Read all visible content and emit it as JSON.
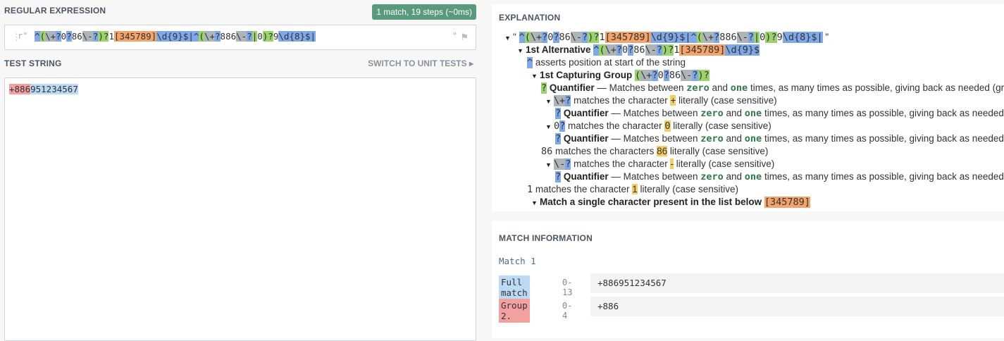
{
  "regex": {
    "title": "REGULAR EXPRESSION",
    "badge": "1 match, 19 steps (~0ms)",
    "prefix": "r\"",
    "suffix": "\"",
    "parts": [
      {
        "t": "^",
        "c": "hb"
      },
      {
        "t": "(",
        "c": "hg"
      },
      {
        "t": "\\+",
        "c": "hgr"
      },
      {
        "t": "?",
        "c": "hb"
      },
      {
        "t": "0",
        "c": ""
      },
      {
        "t": "?",
        "c": "hb"
      },
      {
        "t": "86",
        "c": ""
      },
      {
        "t": "\\-",
        "c": "hgr"
      },
      {
        "t": "?",
        "c": "hb"
      },
      {
        "t": ")",
        "c": "hg"
      },
      {
        "t": "?",
        "c": "hg"
      },
      {
        "t": "1",
        "c": ""
      },
      {
        "t": "[",
        "c": "ho"
      },
      {
        "t": "345789",
        "c": "ho"
      },
      {
        "t": "]",
        "c": "ho"
      },
      {
        "t": "\\d",
        "c": "hb"
      },
      {
        "t": "{9}",
        "c": "hb"
      },
      {
        "t": "$",
        "c": "hb"
      },
      {
        "t": "|",
        "c": "hb"
      },
      {
        "t": "^",
        "c": "hb"
      },
      {
        "t": "(",
        "c": "hg"
      },
      {
        "t": "\\+",
        "c": "hgr"
      },
      {
        "t": "?",
        "c": "hb"
      },
      {
        "t": "886",
        "c": ""
      },
      {
        "t": "\\-",
        "c": "hgr"
      },
      {
        "t": "?",
        "c": "hb"
      },
      {
        "t": "|",
        "c": "hg"
      },
      {
        "t": "0",
        "c": ""
      },
      {
        "t": ")",
        "c": "hg"
      },
      {
        "t": "?",
        "c": "hg"
      },
      {
        "t": "9",
        "c": ""
      },
      {
        "t": "\\d",
        "c": "hb"
      },
      {
        "t": "{8}",
        "c": "hb"
      },
      {
        "t": "$",
        "c": "hb"
      },
      {
        "t": "|",
        "c": "hb"
      }
    ]
  },
  "test": {
    "title": "TEST STRING",
    "switch": "SWITCH TO UNIT TESTS",
    "match_group": "+886",
    "match_rest": "951234567"
  },
  "explanation": {
    "title": "EXPLANATION",
    "rows": [
      {
        "indent": 18,
        "tri": true,
        "html": "\" <span class='mono'><span class='hb'>^</span><span class='hg'>(</span><span class='hgr'>\\+</span><span class='hb'>?</span>0<span class='hb'>?</span>86<span class='hgr'>\\-</span><span class='hb'>?</span><span class='hg'>)?</span>1<span class='ho'>[345789]</span><span class='hb'>\\d{9}$|</span><span class='hb'>^</span><span class='hg'>(</span><span class='hgr'>\\+</span><span class='hb'>?</span>886<span class='hgr'>\\-</span><span class='hb'>?</span><span class='hg'>|</span>0<span class='hg'>)?</span>9<span class='hb'>\\d{8}$|</span></span> \""
      },
      {
        "indent": 36,
        "tri": true,
        "html": "<b>1st Alternative</b> <span class='mono'><span class='hb'>^</span><span class='hg'>(</span><span class='hgr'>\\+</span><span class='hb'>?</span>0<span class='hb'>?</span>86<span class='hgr'>\\-</span><span class='hb'>?</span><span class='hg'>)?</span>1<span class='ho'>[345789]</span><span class='hb'>\\d{9}$</span></span>"
      },
      {
        "indent": 50,
        "tri": false,
        "html": "<span class='hb mono'>^</span> asserts position at start of the string"
      },
      {
        "indent": 56,
        "tri": true,
        "html": "<b>1st Capturing Group</b> <span class='mono'><span class='hg'>(</span><span class='hgr'>\\+</span><span class='hb'>?</span>0<span class='hb'>?</span>86<span class='hgr'>\\-</span><span class='hb'>?</span><span class='hg'>)?</span></span>"
      },
      {
        "indent": 70,
        "tri": false,
        "html": "<span class='hg mono'>?</span> <b>Quantifier</b> — Matches between <span class='mono zw'>zero</span> and <span class='mono zw'>one</span> times, as many times as possible, giving back as needed (greedy)"
      },
      {
        "indent": 76,
        "tri": true,
        "html": "<span class='mono'><span class='hgr'>\\+</span><span class='hb'>?</span></span> matches the character <span class='hy'>+</span> literally (case sensitive)"
      },
      {
        "indent": 90,
        "tri": false,
        "html": "<span class='hb mono'>?</span> <b>Quantifier</b> — Matches between <span class='mono zw'>zero</span> and <span class='mono zw'>one</span> times, as many times as possible, giving back as needed (greedy)"
      },
      {
        "indent": 76,
        "tri": true,
        "html": "<span class='mono'>0<span class='hb'>?</span></span> matches the character <span class='hy mono'>0</span> literally (case sensitive)"
      },
      {
        "indent": 90,
        "tri": false,
        "html": "<span class='hb mono'>?</span> <b>Quantifier</b> — Matches between <span class='mono zw'>zero</span> and <span class='mono zw'>one</span> times, as many times as possible, giving back as needed (greedy)"
      },
      {
        "indent": 70,
        "tri": false,
        "html": "<span class='mono'>86</span> matches the characters <span class='hy'>86</span> literally (case sensitive)"
      },
      {
        "indent": 76,
        "tri": true,
        "html": "<span class='mono'><span class='hgr'>\\-</span><span class='hb'>?</span></span> matches the character <span class='hy'>-</span> literally (case sensitive)"
      },
      {
        "indent": 90,
        "tri": false,
        "html": "<span class='hb mono'>?</span> <b>Quantifier</b> — Matches between <span class='mono zw'>zero</span> and <span class='mono zw'>one</span> times, as many times as possible, giving back as needed (greedy)"
      },
      {
        "indent": 50,
        "tri": false,
        "html": "<span class='mono'>1</span> matches the character <span class='hy'>1</span> literally (case sensitive)"
      },
      {
        "indent": 56,
        "tri": true,
        "html": "<b>Match a single character present in the list below</b> <span class='ho mono'>[345789]</span>"
      }
    ]
  },
  "match_info": {
    "title": "MATCH INFORMATION",
    "match_label": "Match 1",
    "rows": [
      {
        "tag": "Full match",
        "tag_class": "hl",
        "range": "0-13",
        "value": "+886951234567"
      },
      {
        "tag": "Group 2.",
        "tag_class": "hr",
        "range": "0-4",
        "value": "+886"
      }
    ]
  }
}
